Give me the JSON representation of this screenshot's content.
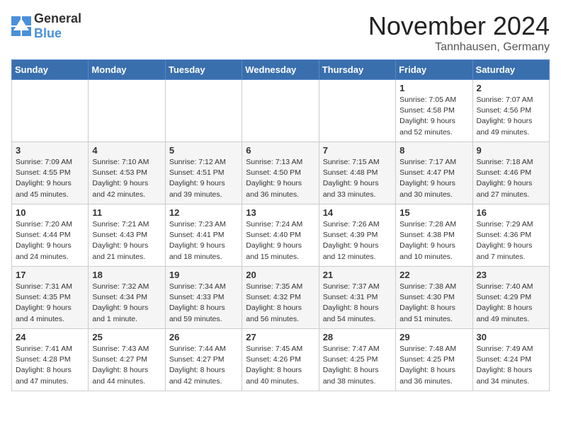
{
  "logo": {
    "general": "General",
    "blue": "Blue"
  },
  "header": {
    "month": "November 2024",
    "location": "Tannhausen, Germany"
  },
  "weekdays": [
    "Sunday",
    "Monday",
    "Tuesday",
    "Wednesday",
    "Thursday",
    "Friday",
    "Saturday"
  ],
  "weeks": [
    [
      {
        "day": null,
        "info": null
      },
      {
        "day": null,
        "info": null
      },
      {
        "day": null,
        "info": null
      },
      {
        "day": null,
        "info": null
      },
      {
        "day": null,
        "info": null
      },
      {
        "day": "1",
        "info": "Sunrise: 7:05 AM\nSunset: 4:58 PM\nDaylight: 9 hours\nand 52 minutes."
      },
      {
        "day": "2",
        "info": "Sunrise: 7:07 AM\nSunset: 4:56 PM\nDaylight: 9 hours\nand 49 minutes."
      }
    ],
    [
      {
        "day": "3",
        "info": "Sunrise: 7:09 AM\nSunset: 4:55 PM\nDaylight: 9 hours\nand 45 minutes."
      },
      {
        "day": "4",
        "info": "Sunrise: 7:10 AM\nSunset: 4:53 PM\nDaylight: 9 hours\nand 42 minutes."
      },
      {
        "day": "5",
        "info": "Sunrise: 7:12 AM\nSunset: 4:51 PM\nDaylight: 9 hours\nand 39 minutes."
      },
      {
        "day": "6",
        "info": "Sunrise: 7:13 AM\nSunset: 4:50 PM\nDaylight: 9 hours\nand 36 minutes."
      },
      {
        "day": "7",
        "info": "Sunrise: 7:15 AM\nSunset: 4:48 PM\nDaylight: 9 hours\nand 33 minutes."
      },
      {
        "day": "8",
        "info": "Sunrise: 7:17 AM\nSunset: 4:47 PM\nDaylight: 9 hours\nand 30 minutes."
      },
      {
        "day": "9",
        "info": "Sunrise: 7:18 AM\nSunset: 4:46 PM\nDaylight: 9 hours\nand 27 minutes."
      }
    ],
    [
      {
        "day": "10",
        "info": "Sunrise: 7:20 AM\nSunset: 4:44 PM\nDaylight: 9 hours\nand 24 minutes."
      },
      {
        "day": "11",
        "info": "Sunrise: 7:21 AM\nSunset: 4:43 PM\nDaylight: 9 hours\nand 21 minutes."
      },
      {
        "day": "12",
        "info": "Sunrise: 7:23 AM\nSunset: 4:41 PM\nDaylight: 9 hours\nand 18 minutes."
      },
      {
        "day": "13",
        "info": "Sunrise: 7:24 AM\nSunset: 4:40 PM\nDaylight: 9 hours\nand 15 minutes."
      },
      {
        "day": "14",
        "info": "Sunrise: 7:26 AM\nSunset: 4:39 PM\nDaylight: 9 hours\nand 12 minutes."
      },
      {
        "day": "15",
        "info": "Sunrise: 7:28 AM\nSunset: 4:38 PM\nDaylight: 9 hours\nand 10 minutes."
      },
      {
        "day": "16",
        "info": "Sunrise: 7:29 AM\nSunset: 4:36 PM\nDaylight: 9 hours\nand 7 minutes."
      }
    ],
    [
      {
        "day": "17",
        "info": "Sunrise: 7:31 AM\nSunset: 4:35 PM\nDaylight: 9 hours\nand 4 minutes."
      },
      {
        "day": "18",
        "info": "Sunrise: 7:32 AM\nSunset: 4:34 PM\nDaylight: 9 hours\nand 1 minute."
      },
      {
        "day": "19",
        "info": "Sunrise: 7:34 AM\nSunset: 4:33 PM\nDaylight: 8 hours\nand 59 minutes."
      },
      {
        "day": "20",
        "info": "Sunrise: 7:35 AM\nSunset: 4:32 PM\nDaylight: 8 hours\nand 56 minutes."
      },
      {
        "day": "21",
        "info": "Sunrise: 7:37 AM\nSunset: 4:31 PM\nDaylight: 8 hours\nand 54 minutes."
      },
      {
        "day": "22",
        "info": "Sunrise: 7:38 AM\nSunset: 4:30 PM\nDaylight: 8 hours\nand 51 minutes."
      },
      {
        "day": "23",
        "info": "Sunrise: 7:40 AM\nSunset: 4:29 PM\nDaylight: 8 hours\nand 49 minutes."
      }
    ],
    [
      {
        "day": "24",
        "info": "Sunrise: 7:41 AM\nSunset: 4:28 PM\nDaylight: 8 hours\nand 47 minutes."
      },
      {
        "day": "25",
        "info": "Sunrise: 7:43 AM\nSunset: 4:27 PM\nDaylight: 8 hours\nand 44 minutes."
      },
      {
        "day": "26",
        "info": "Sunrise: 7:44 AM\nSunset: 4:27 PM\nDaylight: 8 hours\nand 42 minutes."
      },
      {
        "day": "27",
        "info": "Sunrise: 7:45 AM\nSunset: 4:26 PM\nDaylight: 8 hours\nand 40 minutes."
      },
      {
        "day": "28",
        "info": "Sunrise: 7:47 AM\nSunset: 4:25 PM\nDaylight: 8 hours\nand 38 minutes."
      },
      {
        "day": "29",
        "info": "Sunrise: 7:48 AM\nSunset: 4:25 PM\nDaylight: 8 hours\nand 36 minutes."
      },
      {
        "day": "30",
        "info": "Sunrise: 7:49 AM\nSunset: 4:24 PM\nDaylight: 8 hours\nand 34 minutes."
      }
    ]
  ]
}
